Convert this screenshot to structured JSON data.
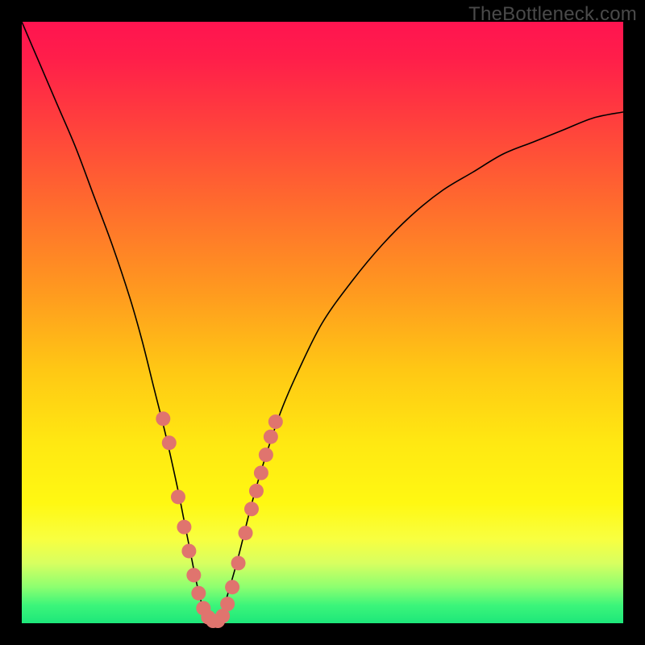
{
  "watermark": "TheBottleneck.com",
  "colors": {
    "frame": "#000000",
    "marker": "#e0746e",
    "curve": "#000000",
    "gradient_top": "#ff1450",
    "gradient_bottom": "#1de77a"
  },
  "chart_data": {
    "type": "line",
    "title": "",
    "xlabel": "",
    "ylabel": "",
    "xlim": [
      0,
      100
    ],
    "ylim": [
      0,
      100
    ],
    "x": [
      0,
      3,
      6,
      9,
      12,
      15,
      18,
      20,
      22,
      24,
      26,
      27,
      28,
      29,
      30,
      31,
      32,
      33,
      34,
      36,
      38,
      40,
      43,
      46,
      50,
      55,
      60,
      65,
      70,
      75,
      80,
      85,
      90,
      95,
      100
    ],
    "y": [
      100,
      93,
      86,
      79,
      71,
      63,
      54,
      47,
      39,
      31,
      22,
      17,
      12,
      7,
      3,
      1,
      0,
      1,
      4,
      11,
      19,
      26,
      35,
      42,
      50,
      57,
      63,
      68,
      72,
      75,
      78,
      80,
      82,
      84,
      85
    ],
    "markers": {
      "note": "salmon dots overlaid on the curve near the valley",
      "x": [
        23.5,
        24.5,
        26,
        27,
        27.8,
        28.6,
        29.4,
        30.2,
        31,
        31.8,
        32.6,
        33.4,
        34.2,
        35,
        36,
        37.2,
        38.2,
        39,
        39.8,
        40.6,
        41.4,
        42.2
      ],
      "y": [
        34,
        30,
        21,
        16,
        12,
        8,
        5,
        2.5,
        1,
        0.4,
        0.4,
        1.2,
        3.2,
        6,
        10,
        15,
        19,
        22,
        25,
        28,
        31,
        33.5
      ]
    }
  }
}
